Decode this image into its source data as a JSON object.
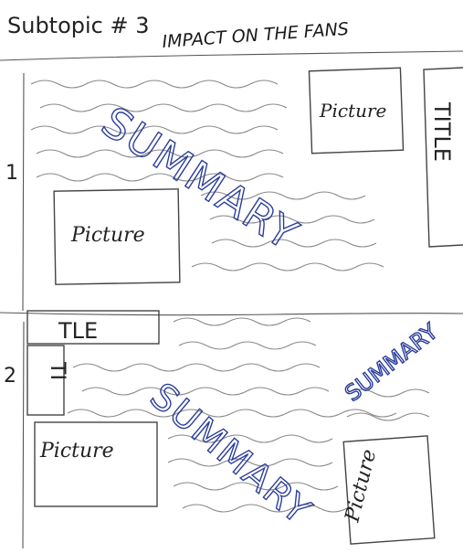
{
  "header": {
    "subtopic": "Subtopic # 3",
    "title": "IMPACT ON THE FANS"
  },
  "panel1": {
    "number": "1",
    "summary": "SUMMARY",
    "picture_top": "Picture",
    "picture_left": "Picture",
    "side_title": "TITLE"
  },
  "panel2": {
    "number": "2",
    "title_top": "TLE",
    "title_side": "TI",
    "summary_main": "SUMMARY",
    "summary_small": "SUMMARY",
    "picture_left": "Picture",
    "picture_right": "Picture"
  },
  "colors": {
    "pencil": "#444444",
    "ink": "#2a3d9a"
  }
}
